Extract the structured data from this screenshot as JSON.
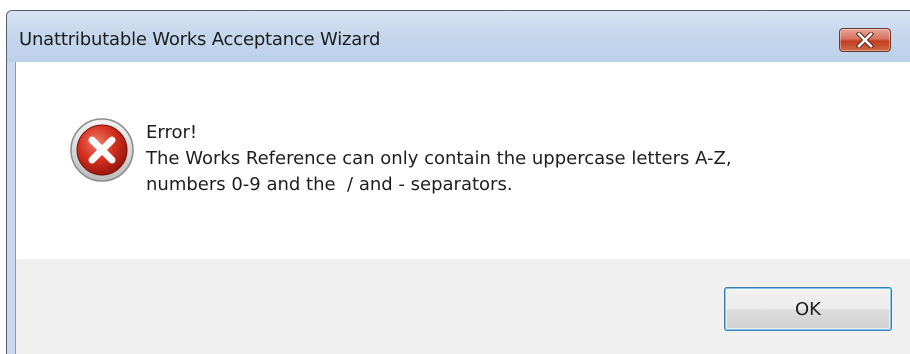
{
  "dialog": {
    "title": "Unattributable Works Acceptance Wizard",
    "icon": "error-icon",
    "close_icon": "close-icon",
    "message": {
      "heading": "Error!",
      "line1": "The Works Reference can only contain the uppercase letters A-Z,",
      "line2": "numbers 0-9 and the  / and - separators."
    },
    "ok_label": "OK"
  },
  "colors": {
    "close_button": "#c33c22",
    "error_icon": "#c8261c",
    "ok_button_border": "#3c7fb1"
  }
}
